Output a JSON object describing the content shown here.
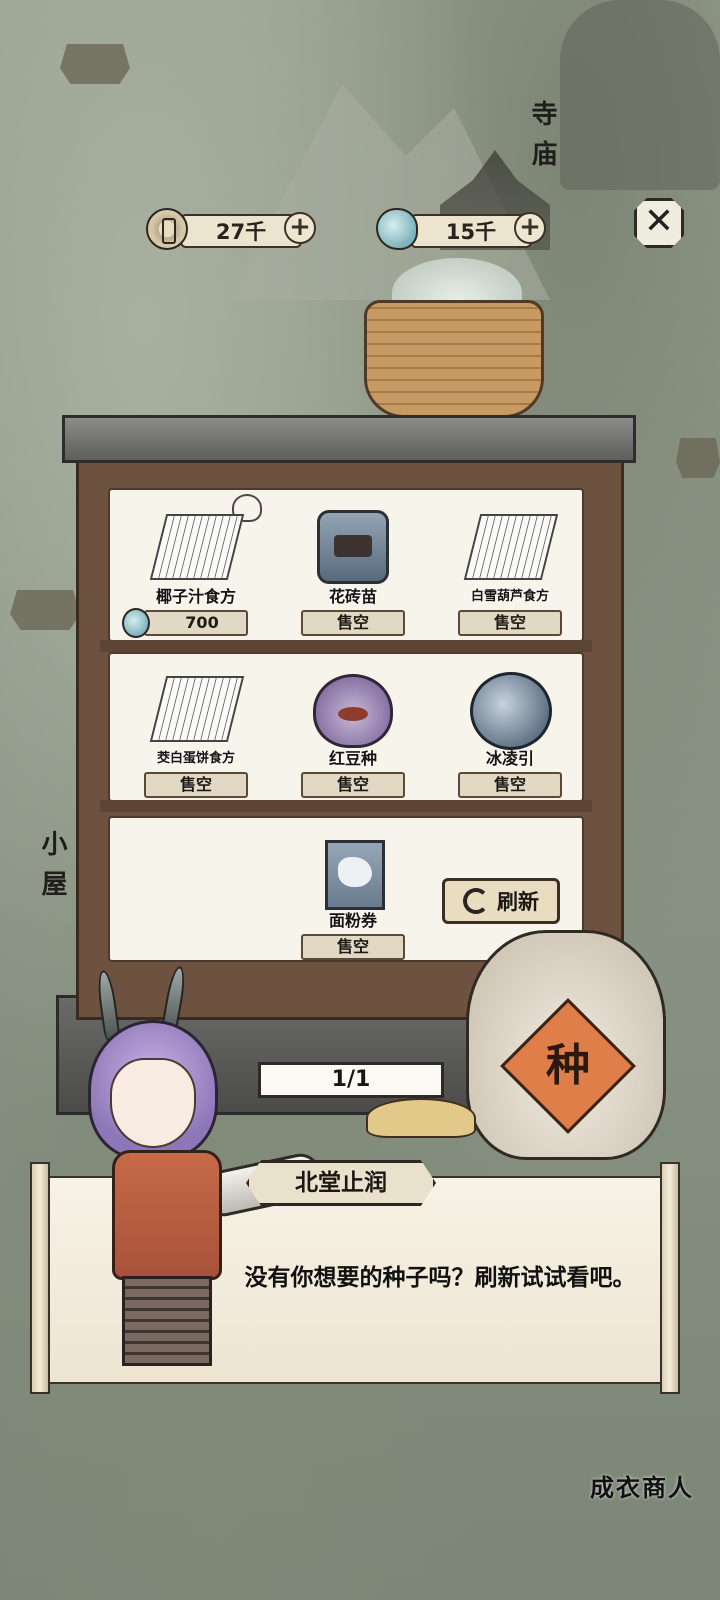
{
  "map": {
    "temple_label": "寺庙",
    "hut_label": "小屋",
    "tailor_label": "成衣商人"
  },
  "resources": {
    "coins": "27千",
    "gems": "15千"
  },
  "shop": {
    "rows": [
      [
        {
          "name": "椰子汁食方",
          "price": "700",
          "icon": "recipe-icon"
        },
        {
          "name": "花砖苗",
          "price": "售空",
          "icon": "seed-jar-icon"
        },
        {
          "name": "白雪葫芦食方",
          "price": "售空",
          "icon": "recipe-icon"
        }
      ],
      [
        {
          "name": "茭白蛋饼食方",
          "price": "售空",
          "icon": "recipe-icon"
        },
        {
          "name": "红豆种",
          "price": "售空",
          "icon": "seed-pouch-icon"
        },
        {
          "name": "冰凌引",
          "price": "售空",
          "icon": "ice-jar-icon"
        }
      ],
      [
        {
          "name": "面粉券",
          "price": "售空",
          "icon": "flour-ticket-icon"
        }
      ]
    ],
    "refresh_label": "刷新",
    "page_indicator": "1/1",
    "sack_char": "种"
  },
  "dialog": {
    "speaker": "北堂止润",
    "text": "没有你想要的种子吗？刷新试试看吧。"
  }
}
